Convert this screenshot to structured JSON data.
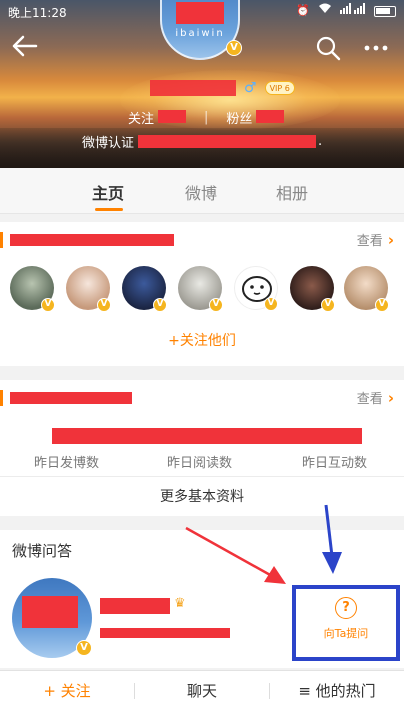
{
  "status_bar": {
    "time": "晚上11:28"
  },
  "profile": {
    "avatar_brand": "ibaiwin",
    "gender_symbol": "♂",
    "vip_label": "VIP 6",
    "following_label": "关注",
    "followers_label": "粉丝",
    "separator": "|",
    "verified_label": "微博认证",
    "verified_trailing": "."
  },
  "tabs": [
    {
      "label": "主页",
      "active": true
    },
    {
      "label": "微博",
      "active": false
    },
    {
      "label": "相册",
      "active": false
    }
  ],
  "following_card": {
    "view_label": "查看",
    "follow_them_label": "+关注他们",
    "avatars": [
      "avatar-1",
      "avatar-2",
      "avatar-3",
      "avatar-4",
      "avatar-5",
      "avatar-6",
      "avatar-7"
    ]
  },
  "basic_info_card": {
    "view_label": "查看",
    "stats": [
      {
        "label": "昨日发博数"
      },
      {
        "label": "昨日阅读数"
      },
      {
        "label": "昨日互动数"
      }
    ],
    "more_info_label": "更多基本资料"
  },
  "qa_card": {
    "title": "微博问答",
    "ask_label": "向Ta提问",
    "ask_icon": "?"
  },
  "bottom_bar": {
    "follow_label": "+ 关注",
    "chat_label": "聊天",
    "hot_label": "≡ 他的热门"
  },
  "colors": {
    "accent": "#ff8200",
    "redaction": "#f0333a",
    "annotation_blue": "#2b44c9",
    "vip_gold": "#f5b51f"
  }
}
